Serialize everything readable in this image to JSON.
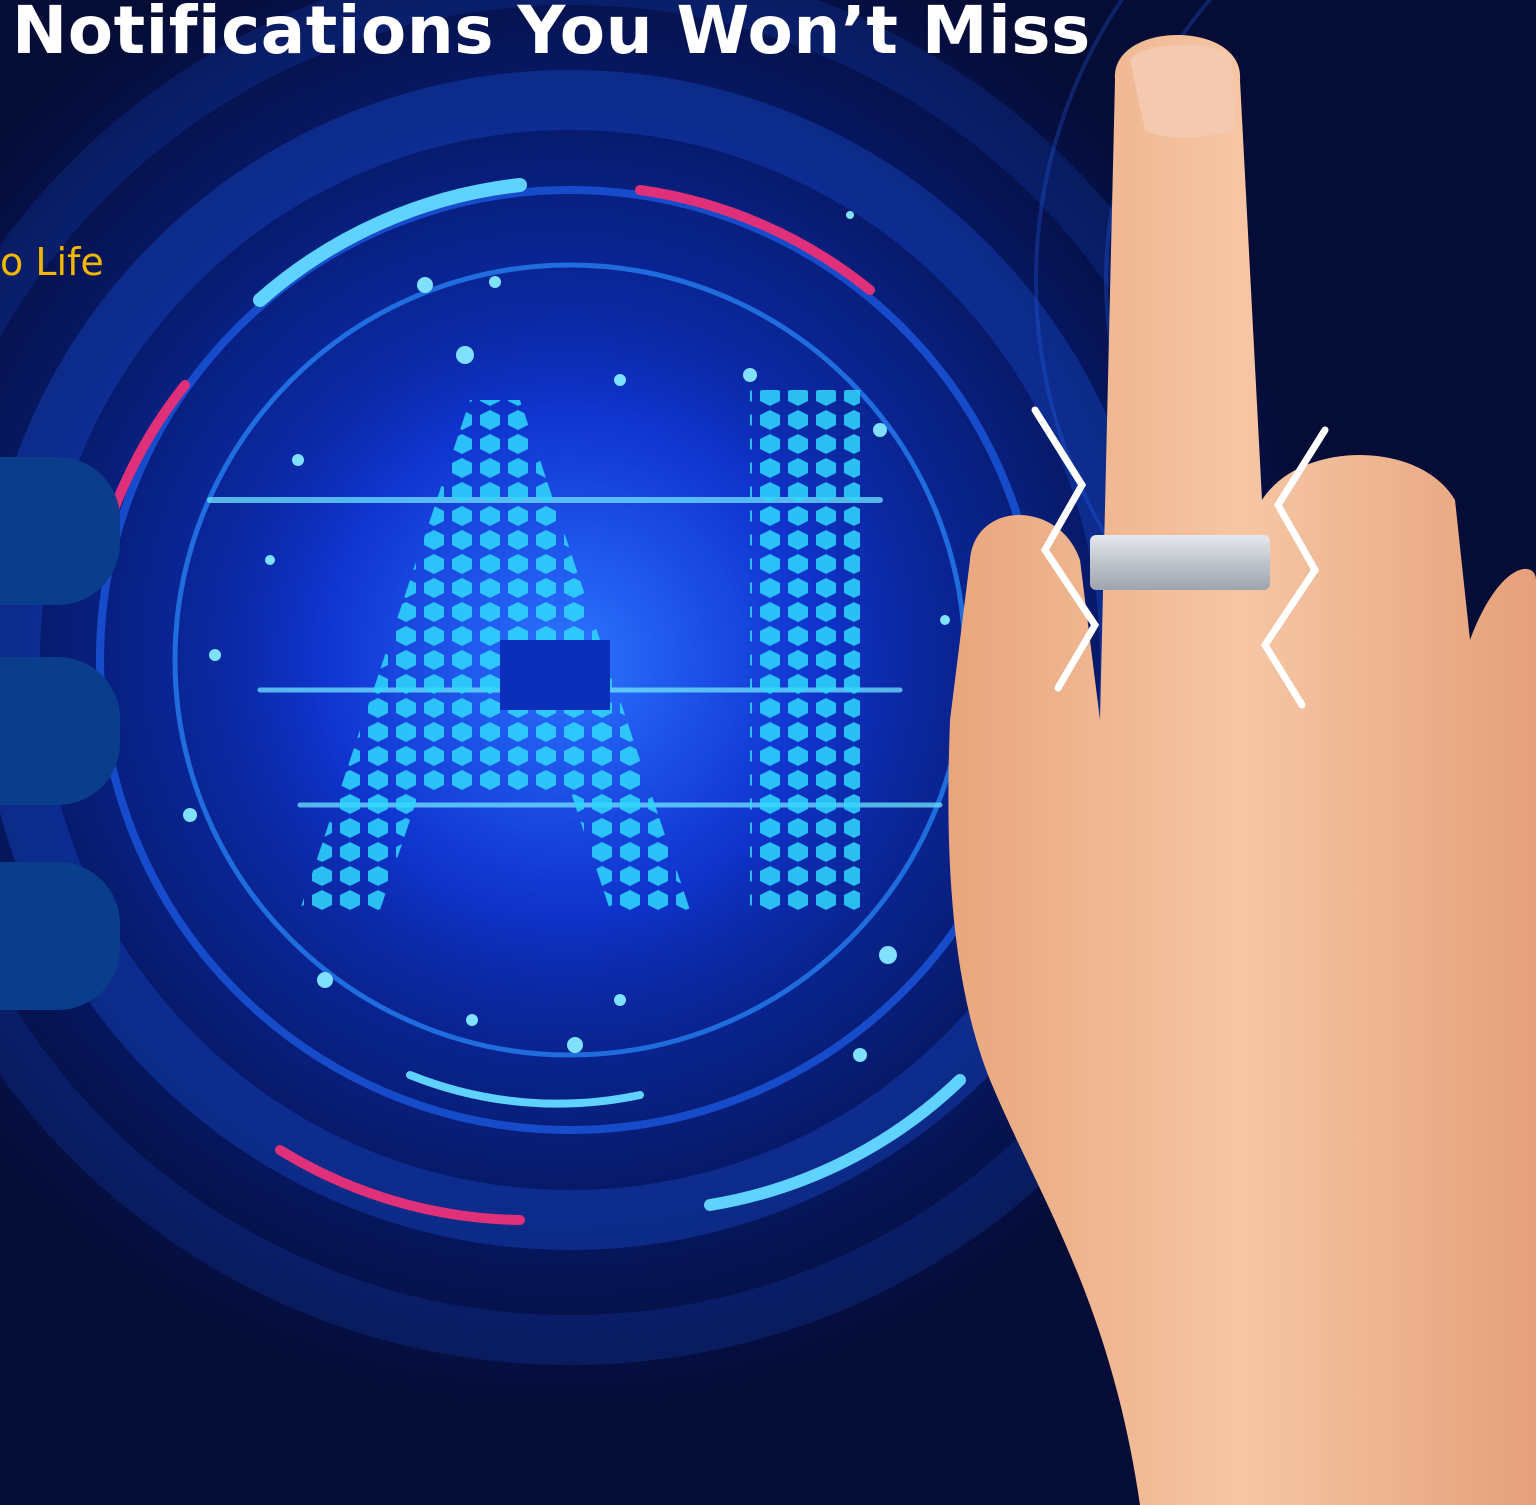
{
  "header": {
    "title": "Notifications You Won’t Miss",
    "subtitle": "o Life"
  },
  "colors": {
    "background": "#06103f",
    "title": "#ffffff",
    "subtitle": "#f2b700",
    "card": "#0a3d8c",
    "glow": "#1fa8ff",
    "accent": "#e0307a"
  },
  "feature_cards": [
    {
      "name": "feature-card-1",
      "label": ""
    },
    {
      "name": "feature-card-2",
      "label": ""
    },
    {
      "name": "feature-card-3",
      "label": ""
    }
  ]
}
